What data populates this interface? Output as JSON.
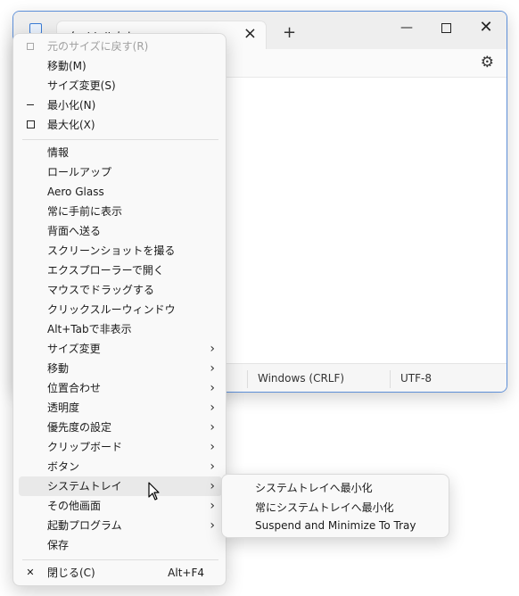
{
  "window": {
    "tab_title": "タイトルなし",
    "status": {
      "eol": "Windows (CRLF)",
      "encoding": "UTF-8"
    }
  },
  "menu": {
    "items": [
      {
        "label": "元のサイズに戻す(R)",
        "icon": "restore-icon",
        "disabled": true
      },
      {
        "label": "移動(M)"
      },
      {
        "label": "サイズ変更(S)"
      },
      {
        "label": "最小化(N)",
        "icon": "minimize-icon"
      },
      {
        "label": "最大化(X)",
        "icon": "maximize-icon"
      },
      {
        "label": "情報"
      },
      {
        "label": "ロールアップ"
      },
      {
        "label": "Aero Glass"
      },
      {
        "label": "常に手前に表示"
      },
      {
        "label": "背面へ送る"
      },
      {
        "label": "スクリーンショットを撮る"
      },
      {
        "label": "エクスプローラーで開く"
      },
      {
        "label": "マウスでドラッグする"
      },
      {
        "label": "クリックスルーウィンドウ"
      },
      {
        "label": "Alt+Tabで非表示"
      },
      {
        "label": "サイズ変更",
        "submenu": true
      },
      {
        "label": "移動",
        "submenu": true
      },
      {
        "label": "位置合わせ",
        "submenu": true
      },
      {
        "label": "透明度",
        "submenu": true
      },
      {
        "label": "優先度の設定",
        "submenu": true
      },
      {
        "label": "クリップボード",
        "submenu": true
      },
      {
        "label": "ボタン",
        "submenu": true
      },
      {
        "label": "システムトレイ",
        "submenu": true,
        "highlighted": true
      },
      {
        "label": "その他画面",
        "submenu": true
      },
      {
        "label": "起動プログラム",
        "submenu": true
      },
      {
        "label": "保存"
      },
      {
        "label": "閉じる(C)",
        "accelerator": "Alt+F4",
        "icon": "close-icon"
      }
    ],
    "submenu_arrow": "›",
    "close_glyph": "✕"
  },
  "submenu": {
    "items": [
      "システムトレイへ最小化",
      "常にシステムトレイへ最小化",
      "Suspend and Minimize To Tray"
    ]
  },
  "colors": {
    "window_border": "#5d8fd8",
    "menu_bg": "#f9f9f9",
    "hover_bg": "#e9e9e9"
  }
}
